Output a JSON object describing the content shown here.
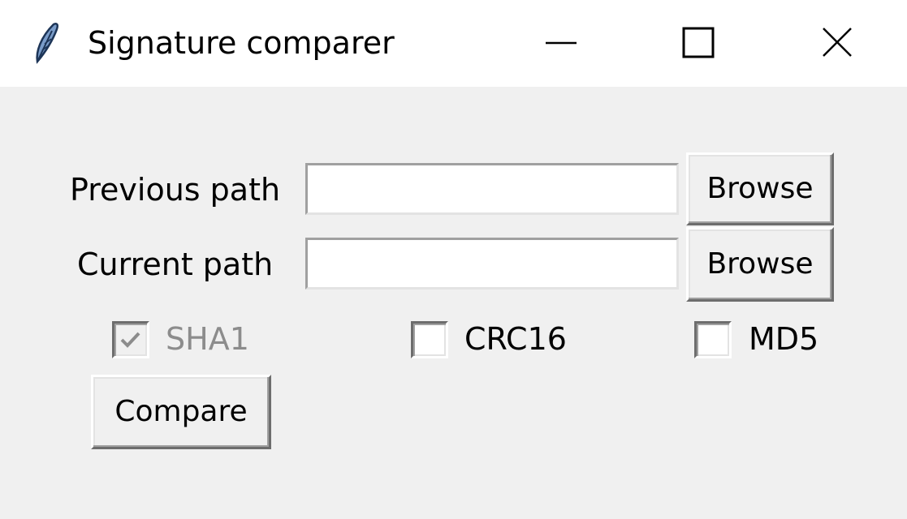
{
  "window": {
    "title": "Signature comparer",
    "icon": "feather-icon",
    "controls": [
      "minimize-icon",
      "maximize-icon",
      "close-icon"
    ]
  },
  "form": {
    "previous_path": {
      "label": "Previous path",
      "value": "",
      "browse_label": "Browse"
    },
    "current_path": {
      "label": "Current path",
      "value": "",
      "browse_label": "Browse"
    },
    "options": [
      {
        "label": "SHA1",
        "checked": true,
        "disabled": true
      },
      {
        "label": "CRC16",
        "checked": false,
        "disabled": false
      },
      {
        "label": "MD5",
        "checked": false,
        "disabled": false
      }
    ],
    "compare_label": "Compare"
  },
  "colors": {
    "background": "#f0f0f0",
    "titlebar": "#ffffff",
    "disabled_text": "#8c8c8c"
  }
}
